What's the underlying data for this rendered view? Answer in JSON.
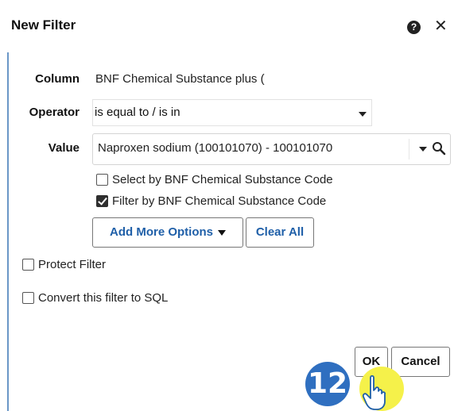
{
  "dialog": {
    "title": "New Filter",
    "help_icon": "?",
    "close_icon": "✕"
  },
  "form": {
    "column": {
      "label": "Column",
      "value": "BNF Chemical Substance plus ("
    },
    "operator": {
      "label": "Operator",
      "value": "is equal to / is in"
    },
    "value": {
      "label": "Value",
      "selected": "Naproxen sodium (100101070) - 100101070"
    },
    "checkboxes": [
      {
        "label": "Select by BNF Chemical Substance Code",
        "checked": false
      },
      {
        "label": "Filter by BNF Chemical Substance Code",
        "checked": true
      }
    ],
    "add_more_options": "Add More Options",
    "clear_all": "Clear All",
    "protect_filter": {
      "label": "Protect Filter",
      "checked": false
    },
    "convert_sql": {
      "label": "Convert this filter to SQL",
      "checked": false
    }
  },
  "footer": {
    "ok": "OK",
    "cancel": "Cancel"
  },
  "overlay": {
    "step_number": "12"
  },
  "colors": {
    "accent_blue": "#1f5fa8",
    "badge_blue": "#2f6fc0",
    "cursor_highlight": "#f5f14a",
    "dialog_border": "#6b97c7"
  }
}
